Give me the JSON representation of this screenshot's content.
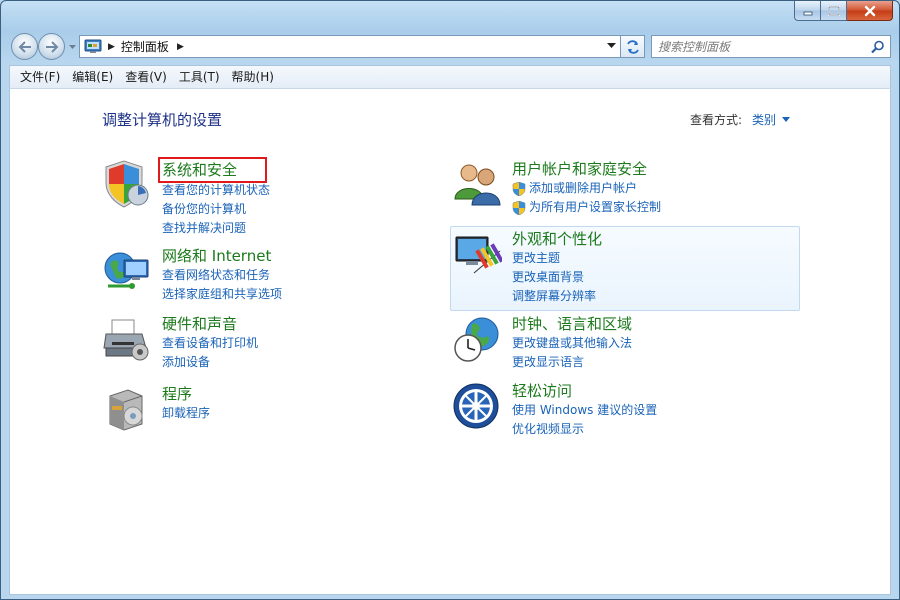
{
  "window": {
    "address_path": "控制面板",
    "search_placeholder": "搜索控制面板"
  },
  "menu": [
    {
      "label": "文件(F)"
    },
    {
      "label": "编辑(E)"
    },
    {
      "label": "查看(V)"
    },
    {
      "label": "工具(T)"
    },
    {
      "label": "帮助(H)"
    }
  ],
  "page": {
    "title": "调整计算机的设置",
    "view_by_label": "查看方式:",
    "view_by_value": "类别"
  },
  "categories": {
    "system": {
      "title": "系统和安全",
      "links": [
        "查看您的计算机状态",
        "备份您的计算机",
        "查找并解决问题"
      ],
      "icon": "shield-icon"
    },
    "network": {
      "title": "网络和 Internet",
      "links": [
        "查看网络状态和任务",
        "选择家庭组和共享选项"
      ],
      "icon": "network-globe-icon"
    },
    "hardware": {
      "title": "硬件和声音",
      "links": [
        "查看设备和打印机",
        "添加设备"
      ],
      "icon": "printer-icon"
    },
    "programs": {
      "title": "程序",
      "links": [
        "卸载程序"
      ],
      "icon": "programs-box-icon"
    },
    "users": {
      "title": "用户帐户和家庭安全",
      "links": [
        "添加或删除用户帐户",
        "为所有用户设置家长控制"
      ],
      "icon": "users-icon"
    },
    "appearance": {
      "title": "外观和个性化",
      "links": [
        "更改主题",
        "更改桌面背景",
        "调整屏幕分辨率"
      ],
      "icon": "monitor-palette-icon"
    },
    "clock": {
      "title": "时钟、语言和区域",
      "links": [
        "更改键盘或其他输入法",
        "更改显示语言"
      ],
      "icon": "clock-globe-icon"
    },
    "ease": {
      "title": "轻松访问",
      "links": [
        "使用 Windows 建议的设置",
        "优化视频显示"
      ],
      "icon": "ease-of-access-icon"
    }
  },
  "colors": {
    "category_title": "#1c7a1c",
    "link": "#1a63b8",
    "page_title": "#1e3287",
    "highlight_box": "#e01a1a"
  }
}
